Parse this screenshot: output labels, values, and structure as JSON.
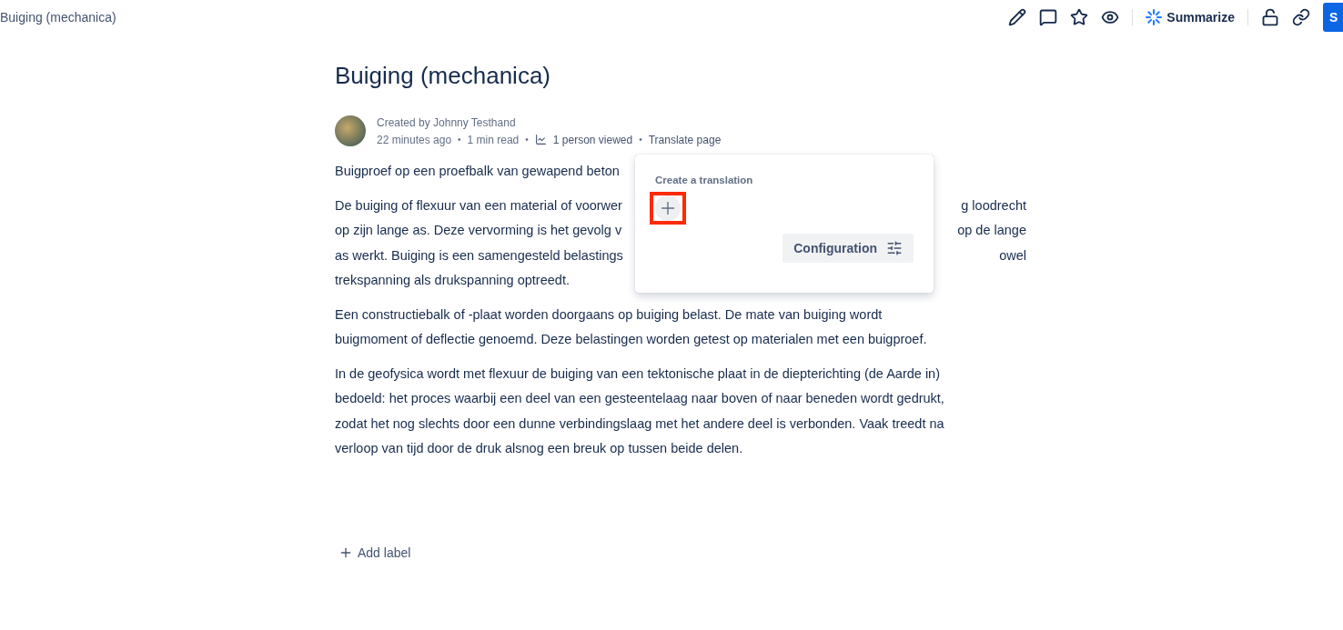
{
  "header": {
    "breadcrumb": "Buiging (mechanica)",
    "summarize": "Summarize",
    "share": "S"
  },
  "page": {
    "title": "Buiging (mechanica)",
    "author": "Created by Johnny Testhand",
    "meta": [
      "22 minutes ago",
      "1 min read"
    ],
    "separator": "•",
    "views": "1 person viewed",
    "translate": "Translate page"
  },
  "body": [
    {
      "lines": [
        [
          "Buigproef op een proefbalk van gewapend beton"
        ]
      ]
    },
    {
      "lines": [
        [
          "De buiging of flexuur van een material of voorwer",
          "g loodrecht"
        ],
        [
          "op zijn lange as. Deze vervorming is het gevolg v",
          "op de lange"
        ],
        [
          "as werkt. Buiging is een samengesteld belastings",
          "owel"
        ],
        [
          "trekspanning als drukspanning optreedt."
        ]
      ]
    },
    {
      "lines": [
        [
          "Een constructiebalk of -plaat worden doorgaans op buiging belast. De mate van buiging wordt"
        ],
        [
          "buigmoment of deflectie genoemd. Deze belastingen worden getest op materialen met een buigproef."
        ]
      ]
    },
    {
      "lines": [
        [
          "In de geofysica wordt met flexuur de buiging van een tektonische plaat in de diepterichting (de Aarde in)"
        ],
        [
          "bedoeld: het proces waarbij een deel van een gesteentelaag naar boven of naar beneden wordt gedrukt,"
        ],
        [
          "zodat het nog slechts door een dunne verbindingslaag met het andere deel is verbonden. Vaak treedt na"
        ],
        [
          "verloop van tijd door de druk alsnog een breuk op tussen beide delen."
        ]
      ]
    }
  ],
  "popup": {
    "heading": "Create a translation",
    "add_highlighted": true,
    "configuration": "Configuration"
  },
  "add_label": "Add label"
}
